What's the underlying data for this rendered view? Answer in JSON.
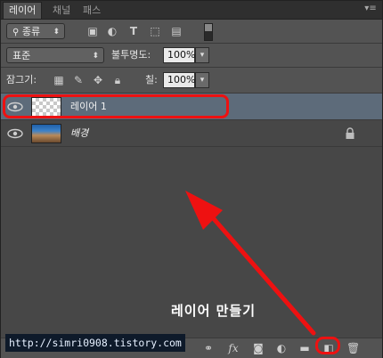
{
  "tabs": [
    {
      "label": "레이어",
      "active": true
    },
    {
      "label": "채널",
      "active": false
    },
    {
      "label": "패스",
      "active": false
    }
  ],
  "filter_row": {
    "kind_label": "종류",
    "filter_icons": [
      "image-filter-icon",
      "adjustment-filter-icon",
      "type-filter-icon",
      "shape-filter-icon",
      "smart-object-filter-icon"
    ]
  },
  "blend_row": {
    "blend_mode": "표준",
    "opacity_label": "불투명도:",
    "opacity_value": "100%"
  },
  "lock_row": {
    "lock_label": "잠그기:",
    "fill_label": "칠:",
    "fill_value": "100%"
  },
  "layers": [
    {
      "name": "레이어 1",
      "selected": true,
      "thumbnail": "transparent",
      "locked": false
    },
    {
      "name": "배경",
      "selected": false,
      "thumbnail": "photo",
      "locked": true
    }
  ],
  "annotation": {
    "caption": "레이어 만들기",
    "url": "http://simri0908.tistory.com"
  },
  "colors": {
    "highlight_red": "#e11111",
    "selected_layer": "#5d6b7a"
  }
}
